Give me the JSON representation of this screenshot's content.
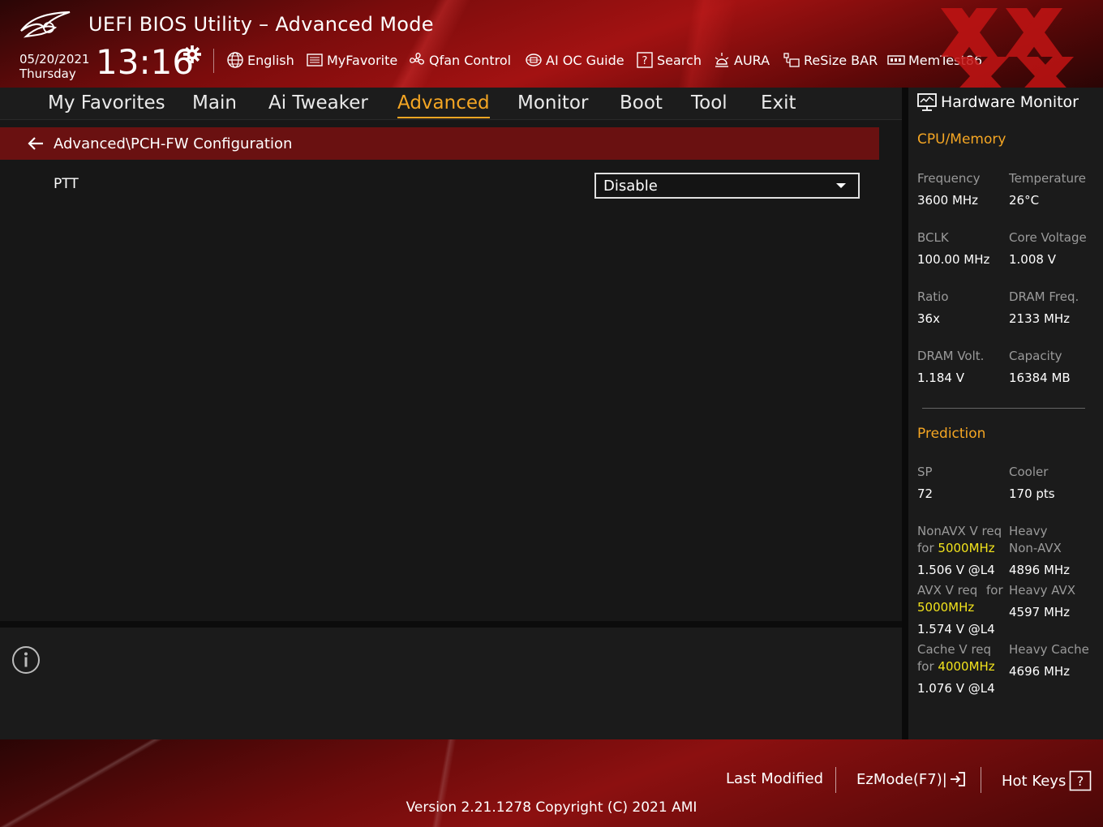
{
  "header": {
    "title": "UEFI BIOS Utility – Advanced Mode",
    "date": "05/20/2021",
    "day": "Thursday",
    "time": "13:16",
    "tools": [
      {
        "label": "English",
        "icon": "globe-icon"
      },
      {
        "label": "MyFavorite",
        "icon": "list-icon"
      },
      {
        "label": "Qfan Control",
        "icon": "fan-icon"
      },
      {
        "label": "AI OC Guide",
        "icon": "chip-icon"
      },
      {
        "label": "Search",
        "icon": "question-box-icon"
      },
      {
        "label": "AURA",
        "icon": "light-icon"
      },
      {
        "label": "ReSize BAR",
        "icon": "resize-bar-icon"
      },
      {
        "label": "MemTest86",
        "icon": "memory-icon"
      }
    ]
  },
  "nav": {
    "tabs": [
      {
        "label": "My Favorites"
      },
      {
        "label": "Main"
      },
      {
        "label": "Ai Tweaker"
      },
      {
        "label": "Advanced",
        "active": true
      },
      {
        "label": "Monitor"
      },
      {
        "label": "Boot"
      },
      {
        "label": "Tool"
      },
      {
        "label": "Exit"
      }
    ]
  },
  "main": {
    "breadcrumb": "Advanced\\PCH-FW Configuration",
    "settings": [
      {
        "label": "PTT",
        "value": "Disable"
      }
    ]
  },
  "hardware_monitor": {
    "title": "Hardware Monitor",
    "cpu_memory": {
      "heading": "CPU/Memory",
      "items": [
        {
          "label": "Frequency",
          "value": "3600 MHz"
        },
        {
          "label": "Temperature",
          "value": "26°C"
        },
        {
          "label": "BCLK",
          "value": "100.00 MHz"
        },
        {
          "label": "Core Voltage",
          "value": "1.008 V"
        },
        {
          "label": "Ratio",
          "value": "36x"
        },
        {
          "label": "DRAM Freq.",
          "value": "2133 MHz"
        },
        {
          "label": "DRAM Volt.",
          "value": "1.184 V"
        },
        {
          "label": "Capacity",
          "value": "16384 MB"
        }
      ]
    },
    "prediction": {
      "heading": "Prediction",
      "sp_label": "SP",
      "sp_value": "72",
      "cooler_label": "Cooler",
      "cooler_value": "170 pts",
      "nonavx_label_1": "NonAVX V req",
      "nonavx_label_for": "for",
      "nonavx_freq": "5000MHz",
      "nonavx_value": "1.506 V @L4",
      "heavy_nonavx_label_1": "Heavy",
      "heavy_nonavx_label_2": "Non-AVX",
      "heavy_nonavx_value": "4896 MHz",
      "avx_label_1": "AVX V req",
      "avx_label_for": "for",
      "avx_freq": "5000MHz",
      "avx_value": "1.574 V @L4",
      "heavy_avx_label": "Heavy AVX",
      "heavy_avx_value": "4597 MHz",
      "cache_label_1": "Cache V req",
      "cache_label_for": "for",
      "cache_freq": "4000MHz",
      "cache_value": "1.076 V @L4",
      "heavy_cache_label": "Heavy Cache",
      "heavy_cache_value": "4696 MHz"
    }
  },
  "footer": {
    "last_modified": "Last Modified",
    "ezmode": "EzMode(F7)|",
    "hot_keys": "Hot Keys",
    "version": "Version 2.21.1278 Copyright (C) 2021 AMI"
  },
  "colors": {
    "accent": "#f5a623",
    "highlight": "#f2e31c",
    "brand_red": "#a31212",
    "breadcrumb_bg": "#6a1111"
  }
}
